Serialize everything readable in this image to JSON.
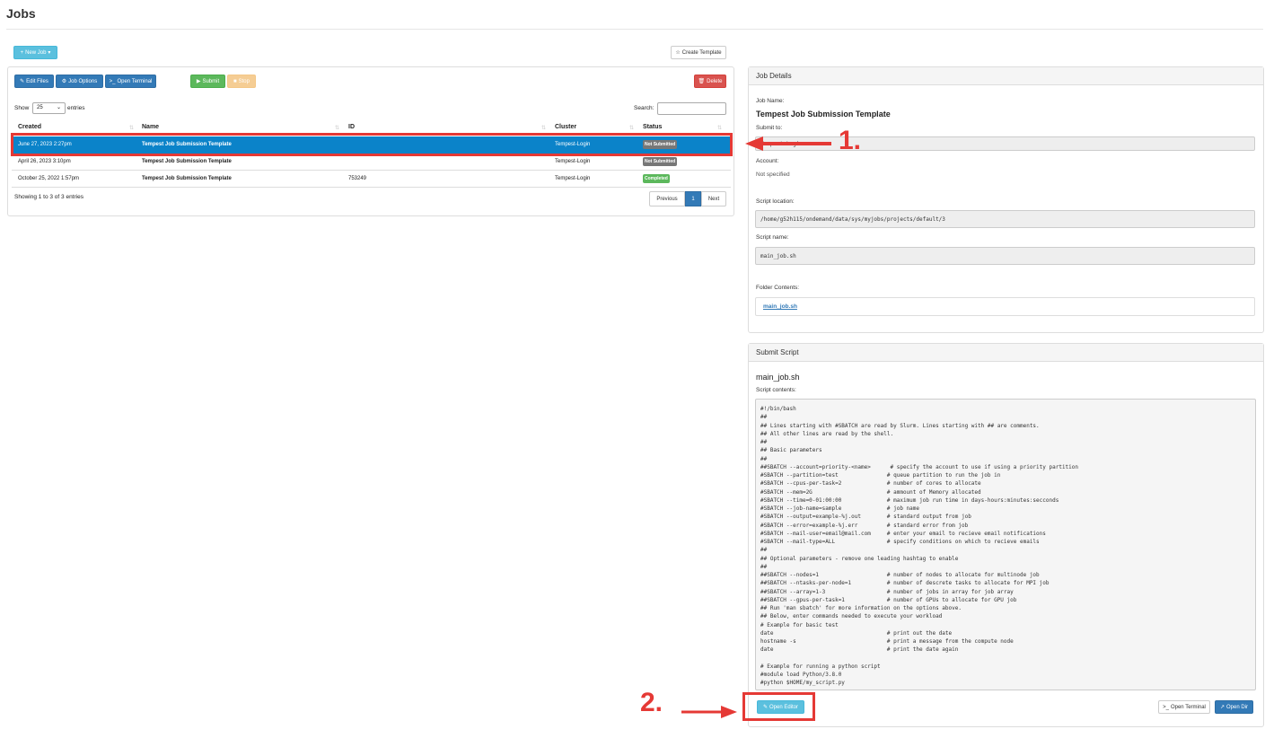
{
  "page": {
    "title": "Jobs"
  },
  "toolbar": {
    "new_job": "New Job",
    "create_template": "Create Template",
    "edit_files": "Edit Files",
    "job_options": "Job Options",
    "open_terminal": "Open Terminal",
    "submit": "Submit",
    "stop": "Stop",
    "delete": "Delete"
  },
  "table": {
    "show_label": "Show",
    "entries_label": "entries",
    "page_size": "25",
    "search_label": "Search:",
    "columns": [
      "Created",
      "Name",
      "ID",
      "Cluster",
      "Status"
    ],
    "rows": [
      {
        "created": "June 27, 2023 2:27pm",
        "name": "Tempest Job Submission Template",
        "id": "",
        "cluster": "Tempest-Login",
        "status": "Not Submitted"
      },
      {
        "created": "April 26, 2023 3:10pm",
        "name": "Tempest Job Submission Template",
        "id": "",
        "cluster": "Tempest-Login",
        "status": "Not Submitted"
      },
      {
        "created": "October 25, 2022 1:57pm",
        "name": "Tempest Job Submission Template",
        "id": "753249",
        "cluster": "Tempest-Login",
        "status": "Completed"
      }
    ],
    "info": "Showing 1 to 3 of 3 entries",
    "pagination": {
      "previous": "Previous",
      "current": "1",
      "next": "Next"
    }
  },
  "job_details": {
    "heading": "Job Details",
    "job_name_label": "Job Name:",
    "job_name": "Tempest Job Submission Template",
    "submit_to_label": "Submit to:",
    "submit_to": "Tempest-Login",
    "account_label": "Account:",
    "account": "Not specified",
    "script_location_label": "Script location:",
    "script_location": "/home/g52h115/ondemand/data/sys/myjobs/projects/default/3",
    "script_name_label": "Script name:",
    "script_name": "main_job.sh",
    "folder_contents_label": "Folder Contents:",
    "folder_file": "main_job.sh"
  },
  "submit_script": {
    "heading": "Submit Script",
    "file_name": "main_job.sh",
    "contents_label": "Script contents:",
    "contents": "#!/bin/bash\n##\n## Lines starting with #SBATCH are read by Slurm. Lines starting with ## are comments.\n## All other lines are read by the shell.\n##\n## Basic parameters\n##\n##SBATCH --account=priority-<name>      # specify the account to use if using a priority partition\n#SBATCH --partition=test               # queue partition to run the job in\n#SBATCH --cpus-per-task=2              # number of cores to allocate\n#SBATCH --mem=2G                       # ammount of Memory allocated\n#SBATCH --time=0-01:00:00              # maximum job run time in days-hours:minutes:secconds\n#SBATCH --job-name=sample              # job name\n#SBATCH --output=example-%j.out        # standard output from job\n#SBATCH --error=example-%j.err         # standard error from job\n#SBATCH --mail-user=email@mail.com     # enter your email to recieve email notifications\n#SBATCH --mail-type=ALL                # specify conditions on which to recieve emails\n##\n## Optional parameters - remove one leading hashtag to enable\n##\n##SBATCH --nodes=1                     # number of nodes to allocate for multinode job\n##SBATCH --ntasks-per-node=1           # number of descrete tasks to allocate for MPI job\n##SBATCH --array=1-3                   # number of jobs in array for job array\n##SBATCH --gpus-per-task=1             # number of GPUs to allocate for GPU job\n## Run 'man sbatch' for more information on the options above.\n## Below, enter commands needed to execute your workload\n# Example for basic test\ndate                                   # print out the date\nhostname -s                            # print a message from the compute node\ndate                                   # print the date again\n\n# Example for running a python script\n#module load Python/3.8.0\n#python $HOME/my_script.py",
    "open_editor": "Open Editor",
    "open_terminal": "Open Terminal",
    "open_dir": "Open Dir"
  },
  "annotations": {
    "step1": "1.",
    "step2": "2.",
    "color": "#e53935"
  },
  "colors": {
    "selected_row": "#0b83c9",
    "not_submitted": "#777777",
    "completed": "#5cb85c"
  }
}
